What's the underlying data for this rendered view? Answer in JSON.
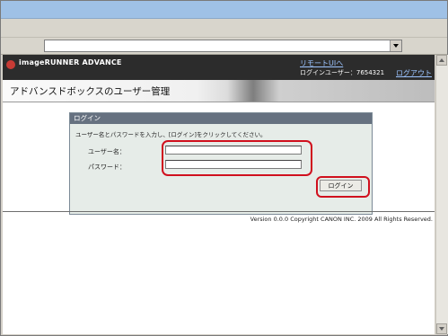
{
  "address_bar": {
    "value": ""
  },
  "brand": {
    "logo_text": "imageRUNNER ADVANCE"
  },
  "top_links": {
    "remote_ui": "リモートUIへ",
    "login_user": "ログインユーザー：7654321",
    "logout": "ログアウト"
  },
  "page": {
    "title": "アドバンスドボックスのユーザー管理"
  },
  "login": {
    "heading": "ログイン",
    "instruction": "ユーザー名とパスワードを入力し、[ログイン]をクリックしてください。",
    "username_label": "ユーザー名：",
    "password_label": "パスワード：",
    "username_value": "",
    "password_value": "",
    "button_label": "ログイン"
  },
  "footer": {
    "copyright": "Version 0.0.0 Copyright CANON INC. 2009 All Rights Reserved."
  },
  "colors": {
    "highlight": "#d0101e",
    "topbar": "#2c2c2c",
    "link": "#9cc4ff"
  }
}
